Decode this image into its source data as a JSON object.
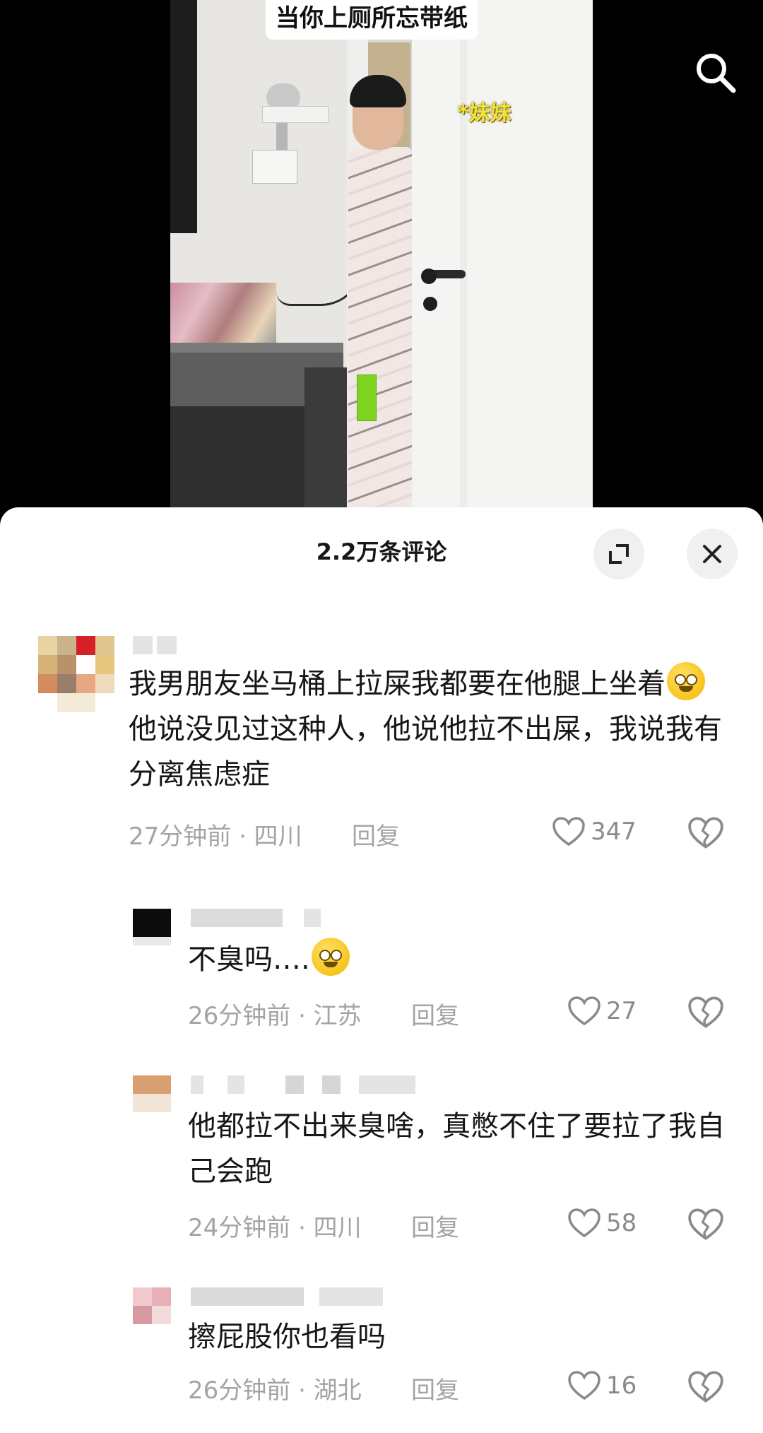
{
  "video": {
    "caption": "当你上厕所忘带纸",
    "sticker": "*妹妹"
  },
  "sheet": {
    "title": "2.2万条评论",
    "icons": {
      "expand": "expand-icon",
      "close": "close-icon",
      "search": "search-icon"
    }
  },
  "comments": [
    {
      "text_a": "我男朋友坐马桶上拉屎我都要在他腿上坐着",
      "emoji": "smiling-face-emoji",
      "text_b": "他说没见过这种人，他说他拉不出屎，我说我有分离焦虑症",
      "meta": "27分钟前 · 四川",
      "reply": "回复",
      "likes": "347"
    },
    {
      "text_a": "不臭吗….",
      "emoji": "flushed-sweat-emoji",
      "text_b": "",
      "meta": "26分钟前 · 江苏",
      "reply": "回复",
      "likes": "27"
    },
    {
      "text_a": "他都拉不出来臭啥，真憋不住了要拉了我自己会跑",
      "meta": "24分钟前 · 四川",
      "reply": "回复",
      "likes": "58"
    },
    {
      "text_a": "擦屁股你也看吗",
      "meta": "26分钟前 · 湖北",
      "reply": "回复",
      "likes": "16"
    }
  ]
}
